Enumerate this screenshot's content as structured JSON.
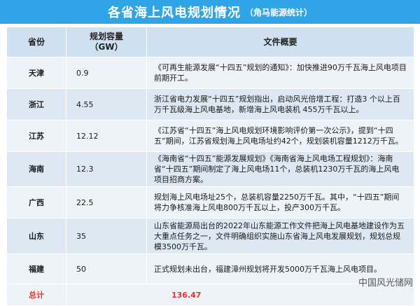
{
  "title": {
    "main": "各省海上风电规划情况",
    "sub": "（角马能源统计）"
  },
  "table": {
    "headers": {
      "province": "省份",
      "capacity_line1": "规划容量",
      "capacity_line2": "（GW）",
      "summary": "文件概要"
    },
    "rows": [
      {
        "province": "天津",
        "capacity": "0.9",
        "summary": "《可再生能源发展“十四五”规划的通知》：加快推进90万千瓦海上风电项目前期开工。"
      },
      {
        "province": "浙江",
        "capacity": "4.55",
        "summary": "浙江省电力发展“十四五”规划指出，启动风光倍增工程：打造3 个以上百万千瓦级海上风电基地，新增海上风电装机 455万千瓦以上。"
      },
      {
        "province": "江苏",
        "capacity": "12.12",
        "summary": "《江苏省“十四五”海上风电规划环境影响评价第一次公示》，提到“十四五”期间，江苏省规划海上风电场址约42个，规划装机容量1212万千瓦。"
      },
      {
        "province": "海南",
        "capacity": "12.3",
        "summary": "《海南省“十四五”能源发展规划》《海南省海上风电场工程规划》：海南省“十四五”期间制定了海上风电场11个，总装机1230万千瓦的海上风电项目招商方案。"
      },
      {
        "province": "广西",
        "capacity": "22.5",
        "summary": "规划海上风电场址25个，总装机容量2250万千瓦。其中，“十四五”期间将力争核准海上风电800万千瓦以上，投产300万千瓦。"
      },
      {
        "province": "山东",
        "capacity": "35",
        "summary": "山东省能源局出台的2022年山东能源工作文件把海上风电基地建设作为五大重点任务之一，文件明确组织实施山东省海上风电发展规划，规划总规模3500万千瓦。"
      },
      {
        "province": "福建",
        "capacity": "50",
        "summary": "正式规划未出台，福建漳州规划将开发5000万千瓦海上风电项目。"
      }
    ],
    "total": {
      "label": "总计",
      "value": "136.47"
    }
  },
  "watermark": "中国风光储网",
  "colors": {
    "title_bg": "#2fa4e7",
    "header_bg": "#cfe1f1",
    "total_text": "#e8342c"
  }
}
